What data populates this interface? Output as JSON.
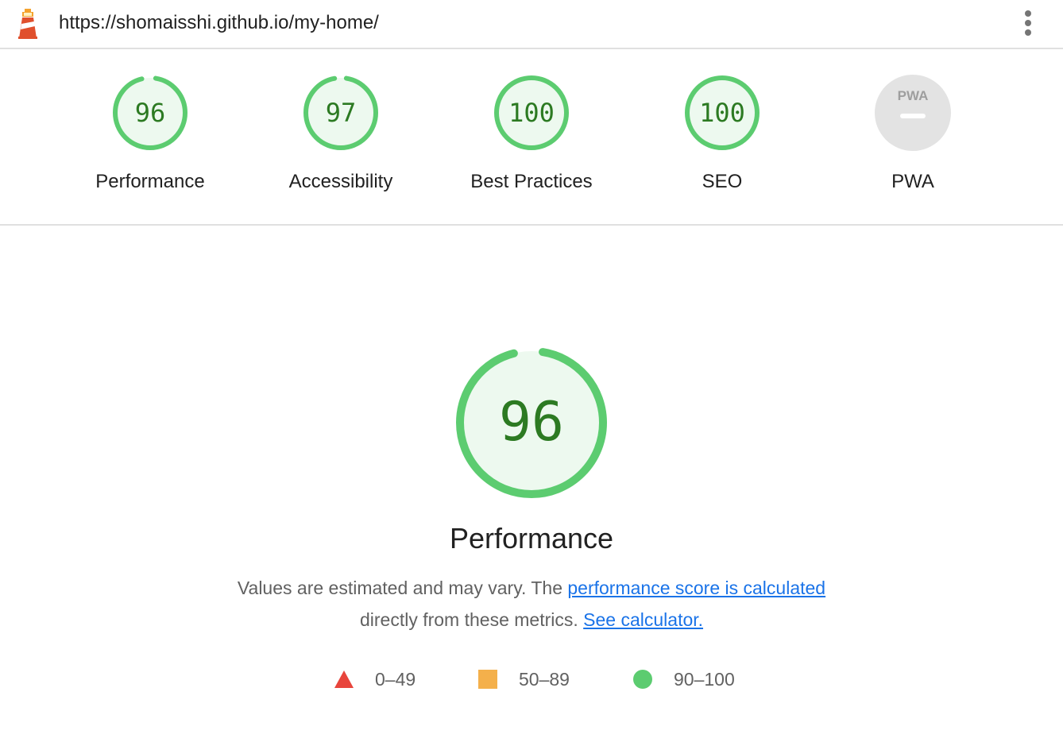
{
  "header": {
    "url": "https://shomaisshi.github.io/my-home/",
    "logo_icon": "lighthouse-icon",
    "menu_icon": "more-vert-icon"
  },
  "categories": [
    {
      "label": "Performance",
      "score": "96",
      "value": 96,
      "status": "pass"
    },
    {
      "label": "Accessibility",
      "score": "97",
      "value": 97,
      "status": "pass"
    },
    {
      "label": "Best Practices",
      "score": "100",
      "value": 100,
      "status": "pass"
    },
    {
      "label": "SEO",
      "score": "100",
      "value": 100,
      "status": "pass"
    },
    {
      "label": "PWA",
      "score": "",
      "badge_text": "PWA",
      "status": "not-applicable"
    }
  ],
  "main": {
    "score": "96",
    "value": 96,
    "title": "Performance",
    "description_text": "Values are estimated and may vary. The ",
    "link1_text": "performance score is calculated",
    "description_mid": " directly from these metrics. ",
    "link2_text": "See calculator."
  },
  "legend": [
    {
      "range": "0–49",
      "shape": "triangle",
      "color": "#e8453c"
    },
    {
      "range": "50–89",
      "shape": "square",
      "color": "#f4b04b"
    },
    {
      "range": "90–100",
      "shape": "circle",
      "color": "#5ccc70"
    }
  ],
  "colors": {
    "pass_ring": "#5ccc70",
    "pass_fill": "#edf9ef",
    "pass_text": "#2c7a22",
    "na_fill": "#e3e3e3",
    "na_text": "#9e9e9e",
    "link": "#1a73e8"
  }
}
